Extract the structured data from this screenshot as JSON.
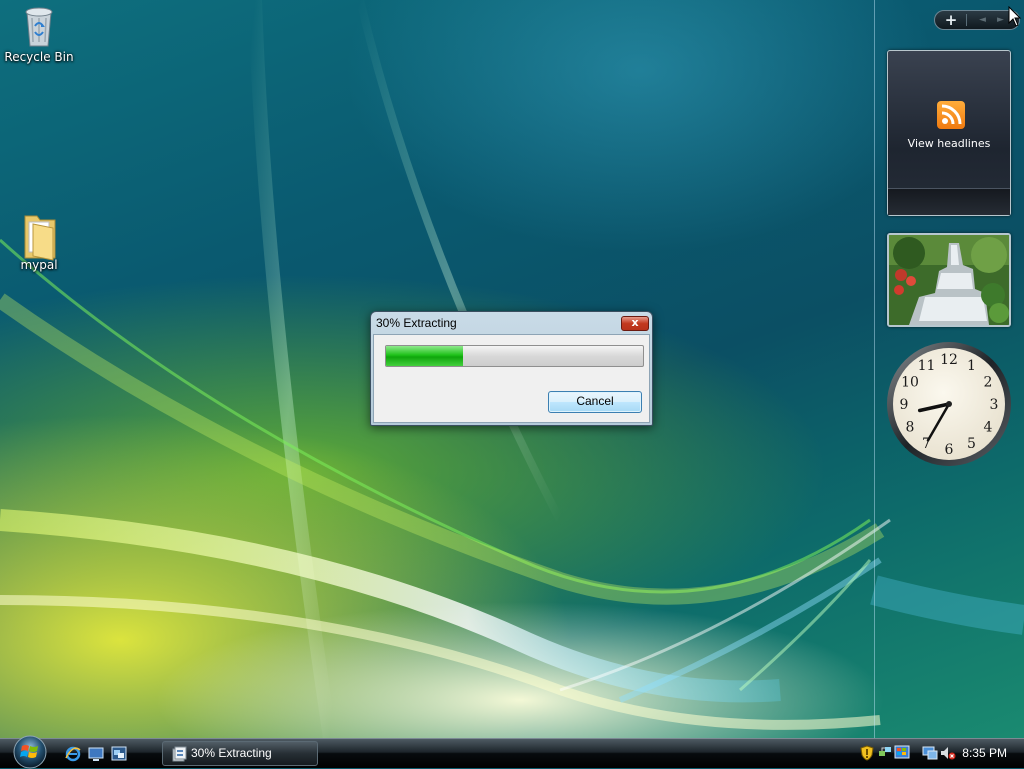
{
  "desktop": {
    "icons": [
      {
        "label": "Recycle Bin",
        "icon": "recycle-bin-icon"
      },
      {
        "label": "mypal",
        "icon": "folder-icon"
      }
    ]
  },
  "sidebar": {
    "controls": {
      "add_label": "+",
      "prev_label": "◄",
      "next_label": "►"
    },
    "feed_gadget": {
      "label": "View headlines",
      "icon": "rss-icon"
    },
    "slideshow_gadget": {
      "subject": "waterfall garden photo"
    },
    "clock_gadget": {
      "numerals": [
        "12",
        "1",
        "2",
        "3",
        "4",
        "5",
        "6",
        "7",
        "8",
        "9",
        "10",
        "11"
      ],
      "time": "8:35"
    }
  },
  "dialog": {
    "title": "30% Extracting",
    "progress_percent": 30,
    "cancel_label": "Cancel",
    "close_label": "x",
    "accent": "#1fc21a"
  },
  "taskbar": {
    "start_icon": "windows-start-orb",
    "quick_launch": [
      "internet-explorer-icon",
      "show-desktop-icon",
      "switch-windows-icon"
    ],
    "task_label": "30% Extracting",
    "tray_icons": [
      "security-shield-icon",
      "network-icon",
      "windows-update-icon",
      "volume-muted-icon"
    ],
    "clock": "8:35 PM"
  }
}
